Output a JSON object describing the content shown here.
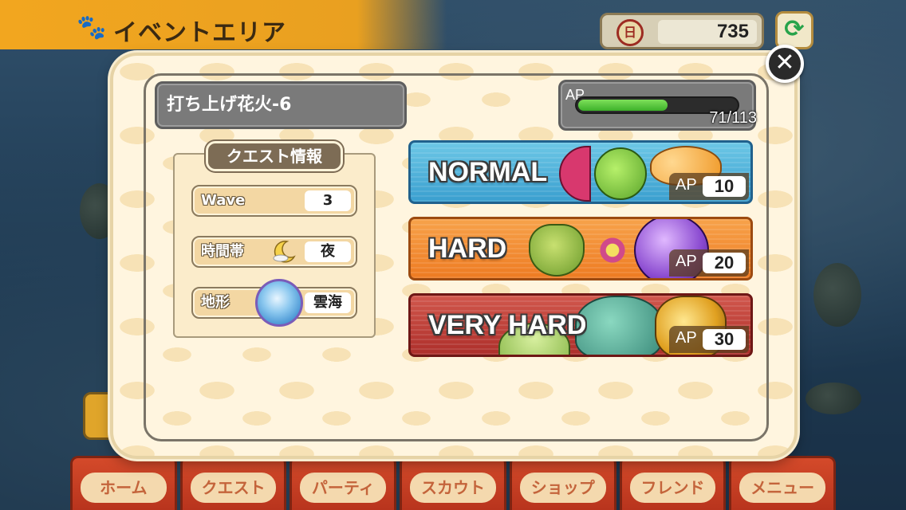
{
  "header": {
    "area_title": "イベントエリア",
    "currency_value": "735"
  },
  "quest": {
    "title": "打ち上げ花火-6",
    "ap": {
      "label": "AP",
      "current": 71,
      "max": 113,
      "display": "71/113"
    }
  },
  "quest_info": {
    "header": "クエスト情報",
    "rows": [
      {
        "label": "Wave",
        "value": "3"
      },
      {
        "label": "時間帯",
        "value": "夜",
        "icon": "moon-icon"
      },
      {
        "label": "地形",
        "value": "雲海",
        "icon": "globe-icon"
      }
    ]
  },
  "difficulties": [
    {
      "label": "NORMAL",
      "ap_label": "AP",
      "ap_cost": "10",
      "color": "#3a9fcf"
    },
    {
      "label": "HARD",
      "ap_label": "AP",
      "ap_cost": "20",
      "color": "#ee7b22"
    },
    {
      "label": "VERY HARD",
      "ap_label": "AP",
      "ap_cost": "30",
      "color": "#ad2f2b"
    }
  ],
  "bottom_nav": [
    {
      "label": "ホーム"
    },
    {
      "label": "クエスト"
    },
    {
      "label": "パーティ"
    },
    {
      "label": "スカウト"
    },
    {
      "label": "ショップ"
    },
    {
      "label": "フレンド"
    },
    {
      "label": "メニュー"
    }
  ],
  "icons": {
    "close": "close-icon",
    "refresh": "refresh-icon",
    "paw": "paw-icon",
    "coin": "coin-icon"
  }
}
